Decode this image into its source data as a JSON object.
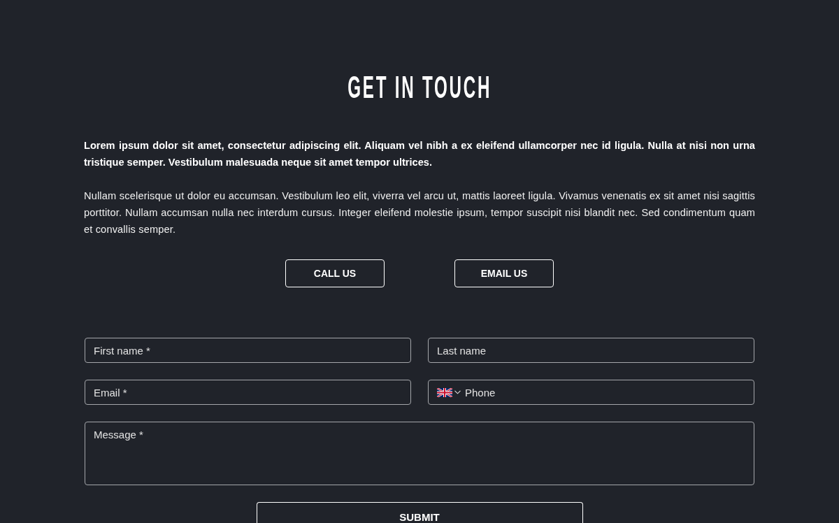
{
  "heading": "GET IN TOUCH",
  "intro": {
    "lead": "Lorem ipsum dolor sit amet, consectetur adipiscing elit. Aliquam vel nibh a ex eleifend ullamcorper nec id ligula. Nulla at nisi non urna tristique semper. Vestibulum malesuada neque sit amet tempor ultrices.",
    "body": "Nullam scelerisque ut dolor eu accumsan. Vestibulum leo elit, viverra vel arcu ut, mattis laoreet ligula. Vivamus venenatis ex sit amet nisi sagittis porttitor. Nullam accumsan nulla nec interdum cursus. Integer eleifend molestie ipsum, tempor suscipit nisi blandit nec. Sed condimentum quam et convallis semper."
  },
  "actions": [
    {
      "label": "CALL US"
    },
    {
      "label": "EMAIL US"
    }
  ],
  "form": {
    "fields": [
      {
        "kind": "text",
        "placeholder": "First name *"
      },
      {
        "kind": "text",
        "placeholder": "Last name"
      },
      {
        "kind": "text",
        "placeholder": "Email *"
      },
      {
        "kind": "phone",
        "placeholder": "Phone"
      },
      {
        "kind": "textarea",
        "placeholder": "Message *"
      }
    ],
    "submit": "SUBMIT"
  }
}
